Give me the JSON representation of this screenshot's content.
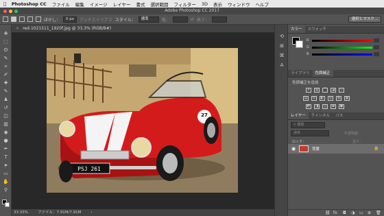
{
  "colors": {
    "menubar_bg": "#e9e9e9",
    "app_bg": "#535353",
    "canvas_bg": "#282828",
    "car_red": "#d41b1b"
  },
  "menubar": {
    "app": "Photoshop CC",
    "items": [
      "ファイル",
      "編集",
      "イメージ",
      "レイヤー",
      "書式",
      "選択範囲",
      "フィルター",
      "3D",
      "表示",
      "ウィンドウ",
      "ヘルプ"
    ]
  },
  "appbar": {
    "title": "Adobe Photoshop CC 2017"
  },
  "options": {
    "feather_label": "ぼかし：",
    "feather_value": "0 px",
    "antialias_label": "アンチエイリアス",
    "style_label": "スタイル：",
    "style_value": "標準",
    "width_label": "幅：",
    "height_label": "高さ：",
    "select_mask_button": "選択とマスク..."
  },
  "document": {
    "tab_title": "red-1021511_1920f.jpg @ 33.3% (RGB/8#)",
    "close_glyph": "×"
  },
  "status": {
    "zoom": "33.33%",
    "file_info": "ファイル：7.91M/7.91M"
  },
  "plate": {
    "text": "PSJ 261"
  },
  "car_number": "27",
  "panels": {
    "color_tabs": [
      "カラー",
      "スウォッチ"
    ],
    "color_sliders": [
      "R",
      "G",
      "B"
    ],
    "adjust_tabs": [
      "ライブラリ",
      "色調補正"
    ],
    "adjust_title": "色調補正を追加",
    "layer_tabs": [
      "レイヤー",
      "チャンネル",
      "パス"
    ],
    "kind_placeholder": "種類",
    "blend_mode": "通常",
    "opacity_label": "不透明度：",
    "lock_label": "ロック：",
    "fill_label": "塗り：",
    "layer_name": "背景"
  },
  "icons": {
    "tools": [
      "move-icon",
      "marquee-icon",
      "lasso-icon",
      "quick-select-icon",
      "crop-icon",
      "eyedropper-icon",
      "healing-brush-icon",
      "brush-icon",
      "clone-stamp-icon",
      "history-brush-icon",
      "eraser-icon",
      "gradient-icon",
      "blur-icon",
      "dodge-icon",
      "pen-icon",
      "type-icon",
      "path-select-icon",
      "rectangle-icon",
      "hand-icon",
      "zoom-icon"
    ],
    "tool_glyphs": [
      "✥",
      "⬚",
      "ʘ",
      "✎",
      "⌗",
      "✐",
      "✚",
      "✎",
      "♟",
      "↺",
      "◫",
      "▥",
      "◉",
      "●",
      "✒",
      "T",
      "➤",
      "▭",
      "✋",
      "⚲"
    ]
  }
}
